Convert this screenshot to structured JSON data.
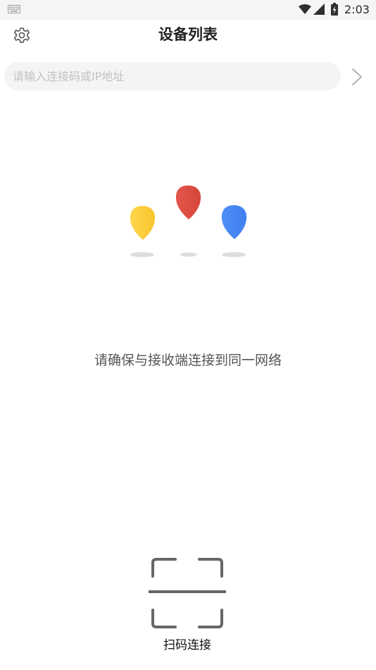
{
  "status_bar": {
    "time": "2:03",
    "icons": [
      "keyboard-icon",
      "wifi-icon",
      "cell-signal-icon",
      "battery-charging-icon"
    ]
  },
  "header": {
    "title": "设备列表",
    "settings_icon": "gear-icon"
  },
  "search": {
    "placeholder": "请输入连接码或IP地址",
    "value": "",
    "go_icon": "chevron-right-icon"
  },
  "illustration": {
    "pins": [
      {
        "name": "yellow-pin",
        "color": "#FFCC3F"
      },
      {
        "name": "red-pin",
        "color": "#DD4C42"
      },
      {
        "name": "blue-pin",
        "color": "#4A8AF4"
      }
    ],
    "shadow_color": "#DDDDDD"
  },
  "hint": "请确保与接收端连接到同一网络",
  "scan": {
    "label": "扫码连接",
    "icon": "scan-frame-icon"
  },
  "colors": {
    "background": "#FFFFFF",
    "status_bar": "#F5F5F5",
    "search_bg": "#F4F4F4",
    "text_primary": "#222222",
    "text_secondary": "#555555",
    "placeholder": "#C2C2C2"
  }
}
